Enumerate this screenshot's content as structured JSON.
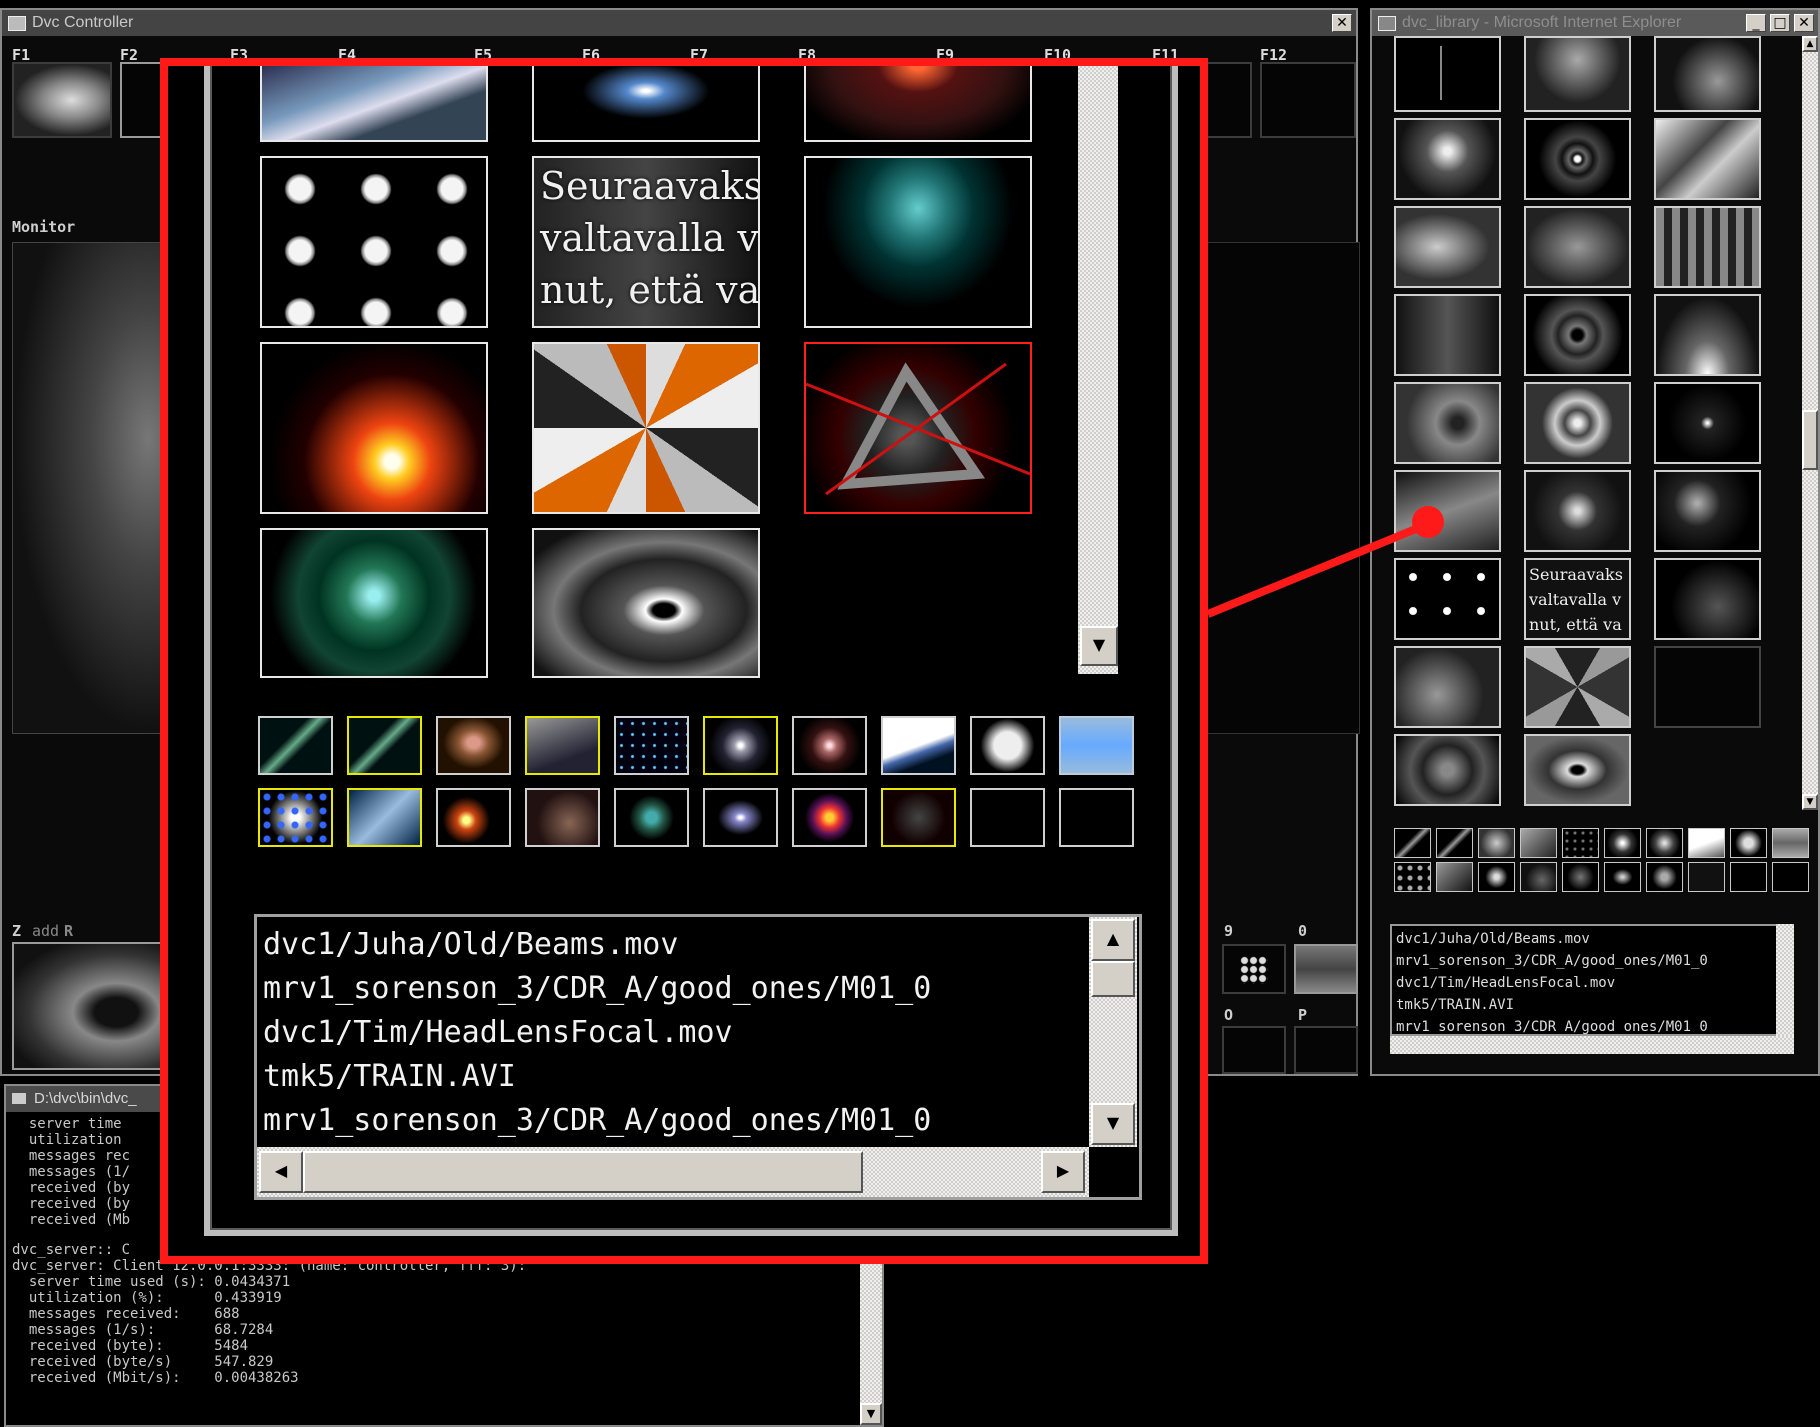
{
  "controller": {
    "title": "Dvc Controller",
    "close": "✕",
    "fkeys": [
      "F1",
      "F2",
      "F3",
      "F4",
      "F5",
      "F6",
      "F7",
      "F8",
      "F9",
      "F10",
      "F11",
      "F12"
    ],
    "monitor_label": "Monitor",
    "z_label": "Z",
    "add_label": "add",
    "r_label": "R",
    "key_9": "9",
    "key_0_top": "0",
    "key_o": "O",
    "key_p": "P"
  },
  "console": {
    "title": "D:\\dvc\\bin\\dvc_",
    "lines_top": [
      "  server time",
      "  utilization",
      "  messages rec",
      "  messages (1/",
      "  received (by",
      "  received (by",
      "  received (Mb"
    ],
    "lines_bottom": [
      "dvc_server:: C",
      "dvc_server: Client 12.0.0.1:3333: (name: controller, fff: 3):",
      "  server time used (s): 0.0434371",
      "  utilization (%):      0.433919",
      "  messages received:    688",
      "  messages (1/s):       68.7284",
      "  received (byte):      5484",
      "  received (byte/s)     547.829",
      "  received (Mbit/s):    0.00438263"
    ]
  },
  "library": {
    "title": "dvc_library - Microsoft Internet Explorer",
    "buttons": [
      "_",
      "□",
      "✕"
    ],
    "overlay_text": "Seuraavaks\nvaltavalla v\nnut, että va",
    "files": [
      "dvc1/Juha/Old/Beams.mov",
      "mrv1_sorenson_3/CDR_A/good_ones/M01_0",
      "dvc1/Tim/HeadLensFocal.mov",
      "tmk5/TRAIN.AVI",
      "mrv1_sorenson_3/CDR_A/good_ones/M01_0"
    ]
  },
  "zoom": {
    "overlay_text": "Seuraavaks\nvaltavalla v\nnut, että va",
    "files": [
      "dvc1/Juha/Old/Beams.mov",
      "mrv1_sorenson_3/CDR_A/good_ones/M01_0",
      "dvc1/Tim/HeadLensFocal.mov",
      "tmk5/TRAIN.AVI",
      "mrv1_sorenson_3/CDR_A/good_ones/M01_0"
    ]
  },
  "colors": {
    "highlight_red": "#ff1a1a",
    "thumb_selected": "#ff1f1f",
    "small_selected": "#e8e800"
  }
}
